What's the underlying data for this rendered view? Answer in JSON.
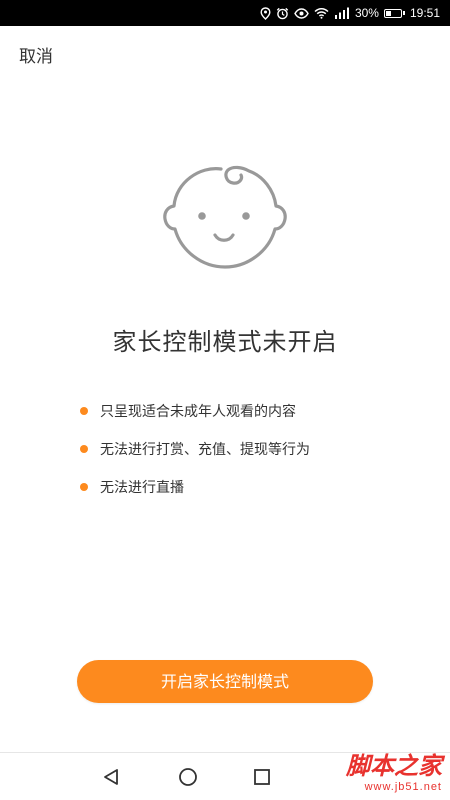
{
  "status_bar": {
    "battery_percent": "30%",
    "time": "19:51",
    "battery_level": 0.3,
    "icons": [
      "location-icon",
      "alarm-icon",
      "eye-icon",
      "wifi-icon",
      "signal-icon",
      "battery-icon"
    ]
  },
  "header": {
    "cancel_label": "取消"
  },
  "main": {
    "title": "家长控制模式未开启",
    "rules": [
      "只呈现适合未成年人观看的内容",
      "无法进行打赏、充值、提现等行为",
      "无法进行直播"
    ]
  },
  "action": {
    "enable_label": "开启家长控制模式"
  },
  "nav_bar": {
    "buttons": [
      "back-icon",
      "home-icon",
      "recents-icon"
    ]
  },
  "watermark": {
    "text": "脚本之家",
    "url": "www.jb51.net"
  },
  "colors": {
    "accent": "#fd8a1e",
    "text": "#333333",
    "face_stroke": "#999999",
    "watermark": "#e8322e"
  }
}
